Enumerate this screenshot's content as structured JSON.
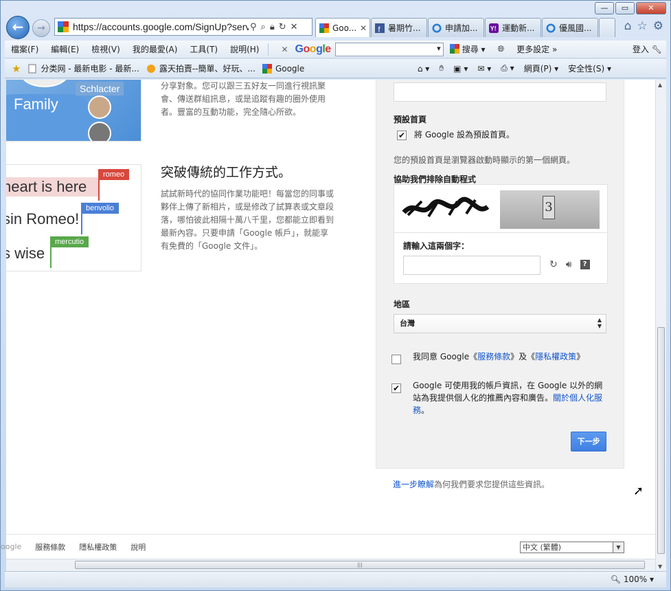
{
  "browser": {
    "url": "https://accounts.google.com/SignUp?serv",
    "tabs": [
      {
        "label": "Goo...",
        "active": true,
        "icon": "google-icon"
      },
      {
        "label": "暑期竹...",
        "active": false,
        "icon": "facebook-icon"
      },
      {
        "label": "申請加...",
        "active": false,
        "icon": "ie-icon"
      },
      {
        "label": "運動新...",
        "active": false,
        "icon": "yahoo-icon"
      },
      {
        "label": "優風國...",
        "active": false,
        "icon": "ie-icon"
      }
    ],
    "menu": [
      "檔案(F)",
      "編輯(E)",
      "檢視(V)",
      "我的最愛(A)",
      "工具(T)",
      "說明(H)"
    ],
    "google_toolbar": {
      "search_label": "搜尋",
      "more_label": "更多設定 »",
      "login_label": "登入"
    },
    "favorites": [
      {
        "label": "分类网 - 最新电影 - 最新...",
        "icon": "page-icon"
      },
      {
        "label": "露天拍賣--簡單、好玩、...",
        "icon": "ruten-icon"
      },
      {
        "label": "Google",
        "icon": "google-icon"
      }
    ],
    "tools": {
      "page_label": "網頁(P) ▾",
      "safety_label": "安全性(S) ▾"
    },
    "zoom": "100%"
  },
  "left": {
    "card_top_family": "Family",
    "card_top_name": "Schlacter",
    "text1": "分享對象。您可以跟三五好友一同進行視訊聚會、傳送群組訊息，或是追蹤有趣的圈外使用者。豐富的互動功能，完全隨心所欲。",
    "card_bot": {
      "line1": "heart is here",
      "line2": "sin Romeo!",
      "line3": "s wise",
      "tag1": "romeo",
      "tag2": "benvolio",
      "tag3": "mercutio"
    },
    "heading2": "突破傳統的工作方式。",
    "text2": "試試新時代的協同作業功能吧！每當您的同事或夥伴上傳了新相片，或是修改了試算表或文章段落，哪怕彼此相隔十萬八千里，您都能立即看到最新內容。只要申請「Google 帳戶」，就能享有免費的「Google 文件」。"
  },
  "form": {
    "homepage_label": "預設首頁",
    "homepage_checkbox": "將 Google 設為預設首頁。",
    "homepage_desc": "您的預設首頁是瀏覽器啟動時顯示的第一個網頁。",
    "captcha_label": "協助我們排除自動程式",
    "captcha_digit": "3",
    "captcha_input_label": "請輸入這兩個字：",
    "region_label": "地區",
    "region_value": "台灣",
    "tos_prefix": "我同意 Google《",
    "tos_link": "服務條款",
    "tos_mid": "》及《",
    "privacy_link": "隱私權政策",
    "tos_suffix": "》",
    "personal_text": "Google 可使用我的帳戶資訊，在 Google 以外的網站為我提供個人化的推薦內容和廣告。",
    "personal_link": "關於個人化服務",
    "personal_suffix": "。",
    "next_button": "下一步",
    "learn_link": "進一步瞭解",
    "learn_text": "為何我們要求您提供這些資訊。"
  },
  "footer": {
    "links": [
      "oogle",
      "服務條款",
      "隱私權政策",
      "說明"
    ],
    "language": "中文 (繁體)"
  }
}
